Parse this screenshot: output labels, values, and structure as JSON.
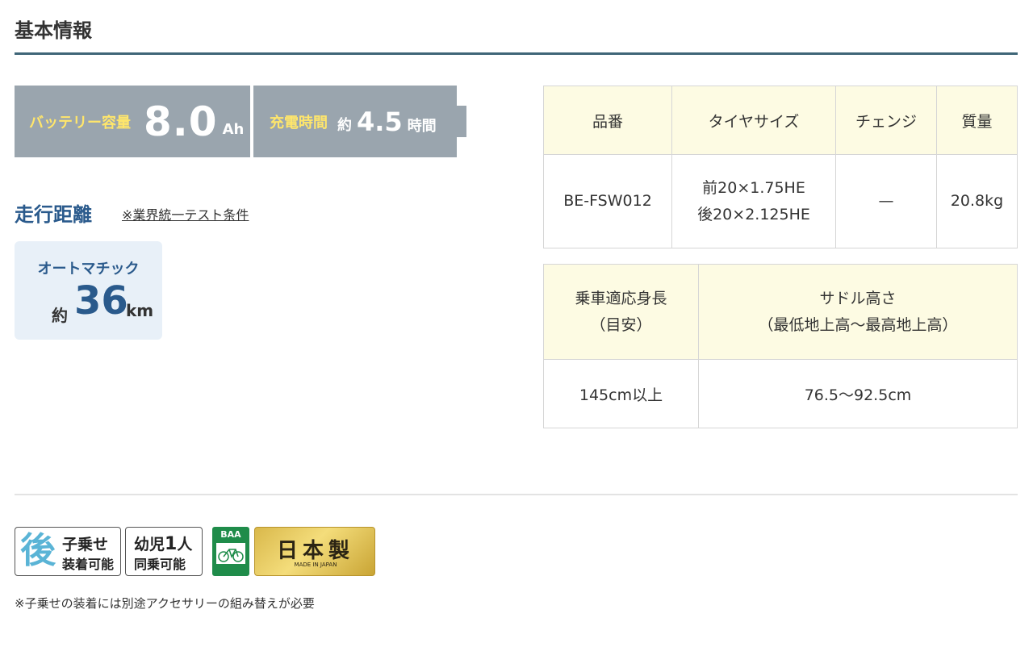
{
  "section_title": "基本情報",
  "battery": {
    "label": "バッテリー容量",
    "value": "8.0",
    "unit": "Ah"
  },
  "charge": {
    "label": "充電時間",
    "prefix": "約",
    "value": "4.5",
    "unit": "時間"
  },
  "range": {
    "title": "走行距離",
    "note": "※業界統一テスト条件",
    "mode": "オートマチック",
    "prefix": "約",
    "value": "36",
    "unit": "km"
  },
  "spec_table": {
    "headers": [
      "品番",
      "タイヤサイズ",
      "チェンジ",
      "質量"
    ],
    "row": {
      "model": "BE-FSW012",
      "tire_front": "前20×1.75HE",
      "tire_rear": "後20×2.125HE",
      "change": "—",
      "weight": "20.8kg"
    }
  },
  "fit_table": {
    "header_height_line1": "乗車適応身長",
    "header_height_line2": "（目安）",
    "header_saddle_line1": "サドル高さ",
    "header_saddle_line2": "（最低地上高～最高地上高）",
    "height": "145cm以上",
    "saddle": "76.5～92.5cm"
  },
  "badges": {
    "child_seat_big": "後",
    "child_seat_line1": "子乗せ",
    "child_seat_line2": "装着可能",
    "infant_line1_a": "幼児",
    "infant_line1_b": "1",
    "infant_line1_c": "人",
    "infant_line2": "同乗可能",
    "baa_text": "BAA",
    "made_in_jp": "日本製",
    "made_in_en": "MADE IN JAPAN"
  },
  "footnote": "※子乗せの装着には別途アクセサリーの組み替えが必要",
  "colors": {
    "accent_blue": "#2a5a8c",
    "spec_bg": "#9aa5ae",
    "spec_label": "#ffe66b",
    "table_header_bg": "#fdfbe3",
    "rule": "#3f6678"
  }
}
